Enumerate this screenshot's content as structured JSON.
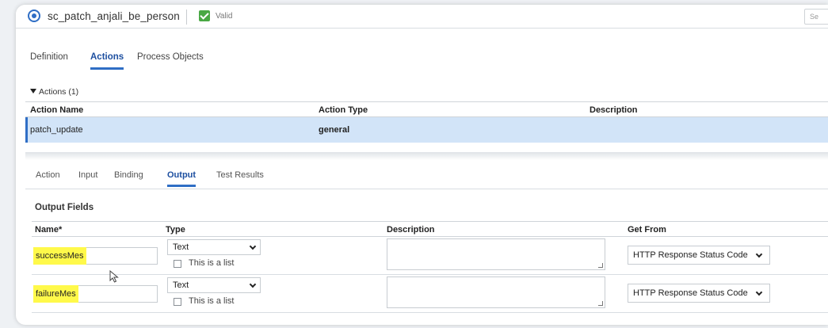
{
  "header": {
    "process_name": "sc_patch_anjali_be_person",
    "valid_label": "Valid",
    "search_placeholder": "Se"
  },
  "main_tabs": [
    {
      "label": "Definition",
      "active": false
    },
    {
      "label": "Actions",
      "active": true
    },
    {
      "label": "Process Objects",
      "active": false
    }
  ],
  "actions": {
    "section_label": "Actions (1)",
    "columns": [
      "Action Name",
      "Action Type",
      "Description"
    ],
    "rows": [
      {
        "name": "patch_update",
        "type": "general",
        "description": ""
      }
    ]
  },
  "sub_tabs": [
    {
      "label": "Action",
      "active": false
    },
    {
      "label": "Input",
      "active": false
    },
    {
      "label": "Binding",
      "active": false
    },
    {
      "label": "Output",
      "active": true
    },
    {
      "label": "Test Results",
      "active": false
    }
  ],
  "output_fields": {
    "title": "Output Fields",
    "columns": [
      "Name*",
      "Type",
      "Description",
      "Get From"
    ],
    "list_label": "This is a list",
    "rows": [
      {
        "name": "successMes",
        "type": "Text",
        "is_list": false,
        "description": "",
        "get_from": "HTTP Response Status Code"
      },
      {
        "name": "failureMes",
        "type": "Text",
        "is_list": false,
        "description": "",
        "get_from": "HTTP Response Status Code"
      }
    ]
  },
  "colors": {
    "accent": "#2f6ec5",
    "selected_row": "#d2e4f8",
    "valid_green": "#49a844",
    "highlight": "#fff94a"
  }
}
